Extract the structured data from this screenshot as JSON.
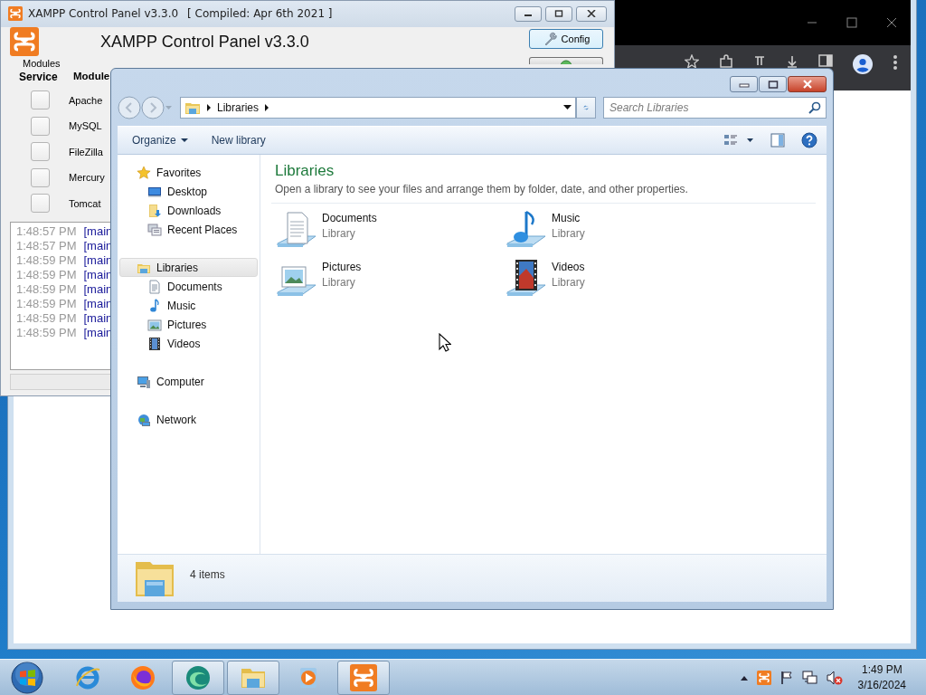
{
  "xampp_window": {
    "title": "XAMPP Control Panel v3.3.0",
    "compiled": "[ Compiled: Apr 6th 2021 ]",
    "heading": "XAMPP Control Panel v3.3.0",
    "group_label": "Modules",
    "columns": [
      "Service",
      "Module"
    ],
    "buttons": [
      {
        "kind": "config",
        "label": "Config"
      },
      {
        "kind": "hidden"
      }
    ],
    "modules": [
      {
        "name": "Apache",
        "checked": false
      },
      {
        "name": "MySQL",
        "checked": false
      },
      {
        "name": "FileZilla",
        "checked": false
      },
      {
        "name": "Mercury",
        "checked": false
      },
      {
        "name": "Tomcat",
        "checked": false
      }
    ],
    "log": [
      {
        "time": "1:48:57 PM",
        "source": "[main"
      },
      {
        "time": "1:48:57 PM",
        "source": "[main"
      },
      {
        "time": "1:48:59 PM",
        "source": "[main"
      },
      {
        "time": "1:48:59 PM",
        "source": "[main"
      },
      {
        "time": "1:48:59 PM",
        "source": "[main"
      },
      {
        "time": "1:48:59 PM",
        "source": "[main"
      },
      {
        "time": "1:48:59 PM",
        "source": "[main"
      },
      {
        "time": "1:48:59 PM",
        "source": "[main"
      }
    ]
  },
  "explorer_window": {
    "address": [
      "Libraries"
    ],
    "search_placeholder": "Search Libraries",
    "commands": [
      {
        "label": "Organize",
        "has_menu": true
      },
      {
        "label": "New library",
        "has_menu": false
      }
    ],
    "nav": [
      {
        "label": "Favorites",
        "kind": "star",
        "selected": false,
        "children": [
          {
            "label": "Desktop",
            "kind": "desktop",
            "selected": false
          },
          {
            "label": "Downloads",
            "kind": "downloads",
            "selected": false
          },
          {
            "label": "Recent Places",
            "kind": "recent",
            "selected": false
          }
        ]
      },
      {
        "label": "Libraries",
        "kind": "libraries",
        "selected": true,
        "children": [
          {
            "label": "Documents",
            "kind": "documents",
            "selected": false
          },
          {
            "label": "Music",
            "kind": "music",
            "selected": false
          },
          {
            "label": "Pictures",
            "kind": "pictures",
            "selected": false
          },
          {
            "label": "Videos",
            "kind": "videos",
            "selected": false
          }
        ]
      },
      {
        "label": "Computer",
        "kind": "computer",
        "selected": false
      },
      {
        "label": "Network",
        "kind": "network",
        "selected": false
      }
    ],
    "heading": "Libraries",
    "description": "Open a library to see your files and arrange them by folder, date, and other properties.",
    "libraries": [
      {
        "name": "Documents",
        "type": "Library",
        "kind": "documents"
      },
      {
        "name": "Music",
        "type": "Library",
        "kind": "music"
      },
      {
        "name": "Pictures",
        "type": "Library",
        "kind": "pictures"
      },
      {
        "name": "Videos",
        "type": "Library",
        "kind": "videos"
      }
    ],
    "status": "4 items"
  },
  "taskbar": {
    "apps": [
      {
        "kind": "ie",
        "active": false
      },
      {
        "kind": "firefox",
        "active": false
      },
      {
        "kind": "swirl",
        "active": true
      },
      {
        "kind": "explorer",
        "active": true
      },
      {
        "kind": "media",
        "active": false
      },
      {
        "kind": "xampp",
        "active": true
      }
    ],
    "clock": {
      "time": "1:49 PM",
      "date": "3/16/2024"
    }
  }
}
